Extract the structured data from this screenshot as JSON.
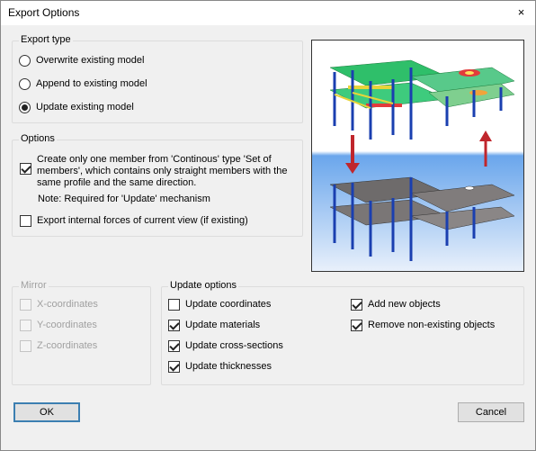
{
  "window": {
    "title": "Export Options",
    "close_glyph": "×"
  },
  "export_type": {
    "label": "Export type",
    "options": [
      {
        "label": "Overwrite existing model",
        "checked": false
      },
      {
        "label": "Append to existing model",
        "checked": false
      },
      {
        "label": "Update existing model",
        "checked": true
      }
    ]
  },
  "options": {
    "label": "Options",
    "single_member": {
      "text": "Create only one member from 'Continous' type 'Set of members', which contains only straight members with the same profile and the same direction.",
      "checked": true
    },
    "note": "Note: Required for 'Update' mechanism",
    "export_forces": {
      "text": "Export internal forces of current view (if existing)",
      "checked": false
    }
  },
  "mirror": {
    "label": "Mirror",
    "items": [
      "X-coordinates",
      "Y-coordinates",
      "Z-coordinates"
    ]
  },
  "update_options": {
    "label": "Update options",
    "left": [
      {
        "label": "Update coordinates",
        "checked": false
      },
      {
        "label": "Update materials",
        "checked": true
      },
      {
        "label": "Update cross-sections",
        "checked": true
      },
      {
        "label": "Update thicknesses",
        "checked": true
      }
    ],
    "right": [
      {
        "label": "Add new objects",
        "checked": true
      },
      {
        "label": "Remove non-existing objects",
        "checked": true
      }
    ]
  },
  "buttons": {
    "ok": "OK",
    "cancel": "Cancel"
  },
  "colors": {
    "accent": "#3c7fb1",
    "arrow": "#c0262c",
    "sky": "#6aa6ec",
    "frame_blue": "#1a3fb0"
  }
}
